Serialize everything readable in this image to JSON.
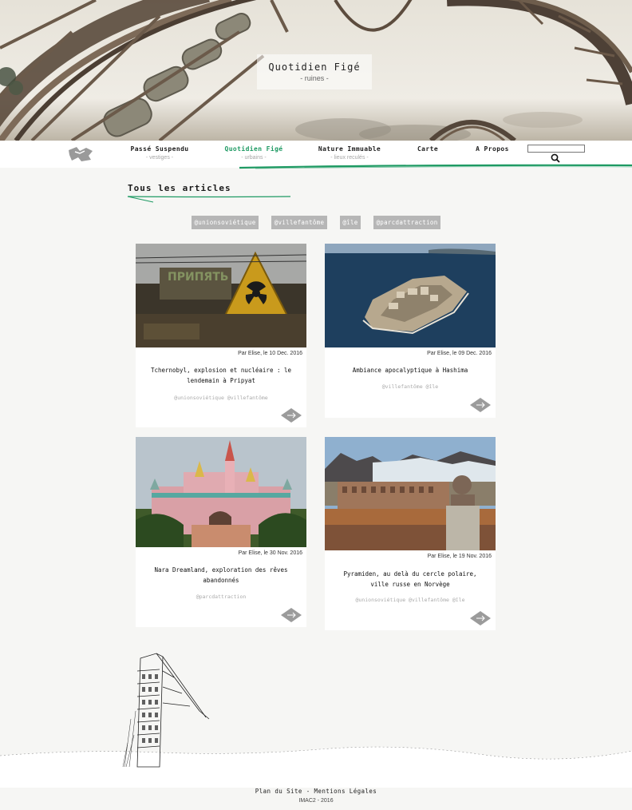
{
  "hero": {
    "title": "Quotidien Figé",
    "subtitle": "- ruines -"
  },
  "nav": {
    "items": [
      {
        "label": "Passé Suspendu",
        "sub": "- vestiges -"
      },
      {
        "label": "Quotidien Figé",
        "sub": "- urbains -"
      },
      {
        "label": "Nature Immuable",
        "sub": "- lieux reculés -"
      },
      {
        "label": "Carte",
        "sub": ""
      },
      {
        "label": "A Propos",
        "sub": ""
      }
    ],
    "active_index": 1,
    "search_placeholder": ""
  },
  "section": {
    "title": "Tous les articles"
  },
  "tags": [
    "@unionsoviétique",
    "@villefantôme",
    "@île",
    "@parcdattraction"
  ],
  "articles": [
    {
      "meta": "Par Elise, le 10 Dec. 2016",
      "title": "Tchernobyl, explosion et nucléaire : le lendemain à Pripyat",
      "tags": "@unionsoviétique @villefantôme"
    },
    {
      "meta": "Par Elise, le 09 Dec. 2016",
      "title": "Ambiance apocalyptique à Hashima",
      "tags": "@villefantôme @île"
    },
    {
      "meta": "Par Elise, le 30 Nov. 2016",
      "title": "Nara Dreamland, exploration des rêves abandonnés",
      "tags": "@parcdattraction"
    },
    {
      "meta": "Par Elise, le 19 Nov. 2016",
      "title": "Pyramiden, au delà du cercle polaire, ville russe en Norvège",
      "tags": "@unionsoviétique @villefantôme @île"
    }
  ],
  "footer": {
    "plan": "Plan du Site",
    "separator": " - ",
    "legal": "Mentions Légales",
    "copyright": "IMAC2 - 2016"
  },
  "colors": {
    "accent": "#1e9a63",
    "tag_bg": "#b6b6b6",
    "page_bg": "#f6f6f4"
  }
}
